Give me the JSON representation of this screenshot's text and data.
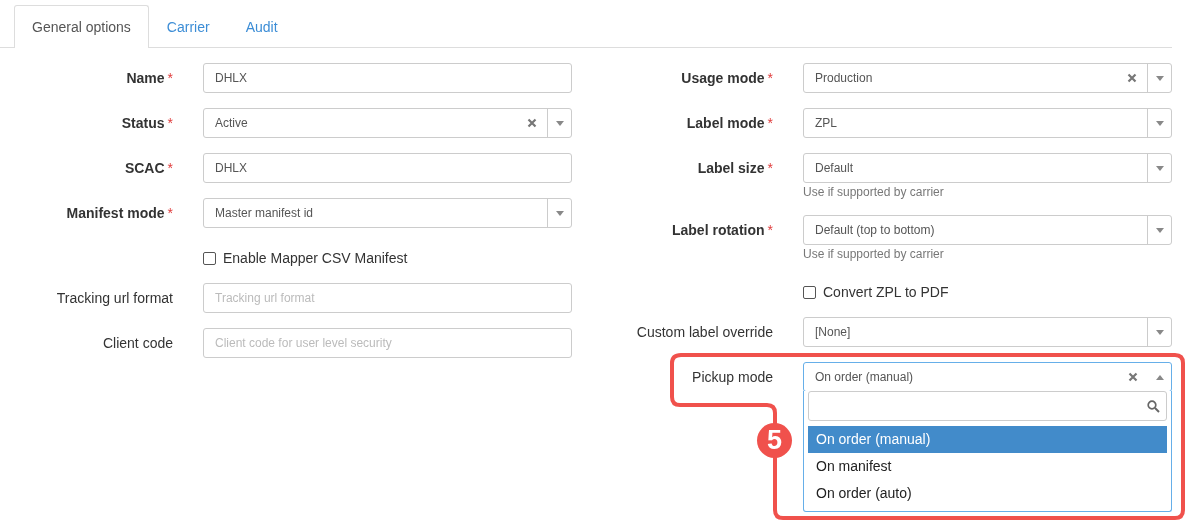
{
  "tabs": [
    {
      "label": "General options",
      "selected": true
    },
    {
      "label": "Carrier",
      "selected": false
    },
    {
      "label": "Audit",
      "selected": false
    }
  ],
  "left_fields": [
    {
      "kind": "text",
      "label": "Name",
      "required_mark": "*",
      "value": "DHLX"
    },
    {
      "kind": "select",
      "label": "Status",
      "required_mark": "*",
      "value": "Active",
      "clearable": true
    },
    {
      "kind": "text",
      "label": "SCAC",
      "required_mark": "*",
      "value": "DHLX"
    },
    {
      "kind": "select",
      "label": "Manifest mode",
      "required_mark": "*",
      "value": "Master manifest id",
      "clearable": false
    },
    {
      "kind": "checkbox",
      "label": "Enable Mapper CSV Manifest",
      "checked": false
    },
    {
      "kind": "text",
      "label": "Tracking url format",
      "placeholder": "Tracking url format"
    },
    {
      "kind": "text",
      "label": "Client code",
      "placeholder": "Client code for user level security"
    }
  ],
  "right_fields": [
    {
      "kind": "select",
      "label": "Usage mode",
      "required_mark": "*",
      "value": "Production",
      "clearable": true
    },
    {
      "kind": "select",
      "label": "Label mode",
      "required_mark": "*",
      "value": "ZPL",
      "clearable": false
    },
    {
      "kind": "select",
      "label": "Label size",
      "required_mark": "*",
      "value": "Default",
      "clearable": false,
      "help": "Use if supported by carrier"
    },
    {
      "kind": "select",
      "label": "Label rotation",
      "required_mark": "*",
      "value": "Default (top to bottom)",
      "clearable": false,
      "help": "Use if supported by carrier"
    },
    {
      "kind": "checkbox",
      "label": "Convert ZPL to PDF",
      "checked": false
    },
    {
      "kind": "select",
      "label": "Custom label override",
      "value": "[None]",
      "clearable": false
    },
    {
      "kind": "select",
      "label": "Pickup mode",
      "value": "On order (manual)",
      "clearable": true,
      "expanded": true,
      "options": [
        {
          "label": "On order (manual)",
          "selected": true
        },
        {
          "label": "On manifest",
          "selected": false
        },
        {
          "label": "On order (auto)",
          "selected": false
        }
      ]
    }
  ],
  "callout": {
    "number": "5"
  }
}
